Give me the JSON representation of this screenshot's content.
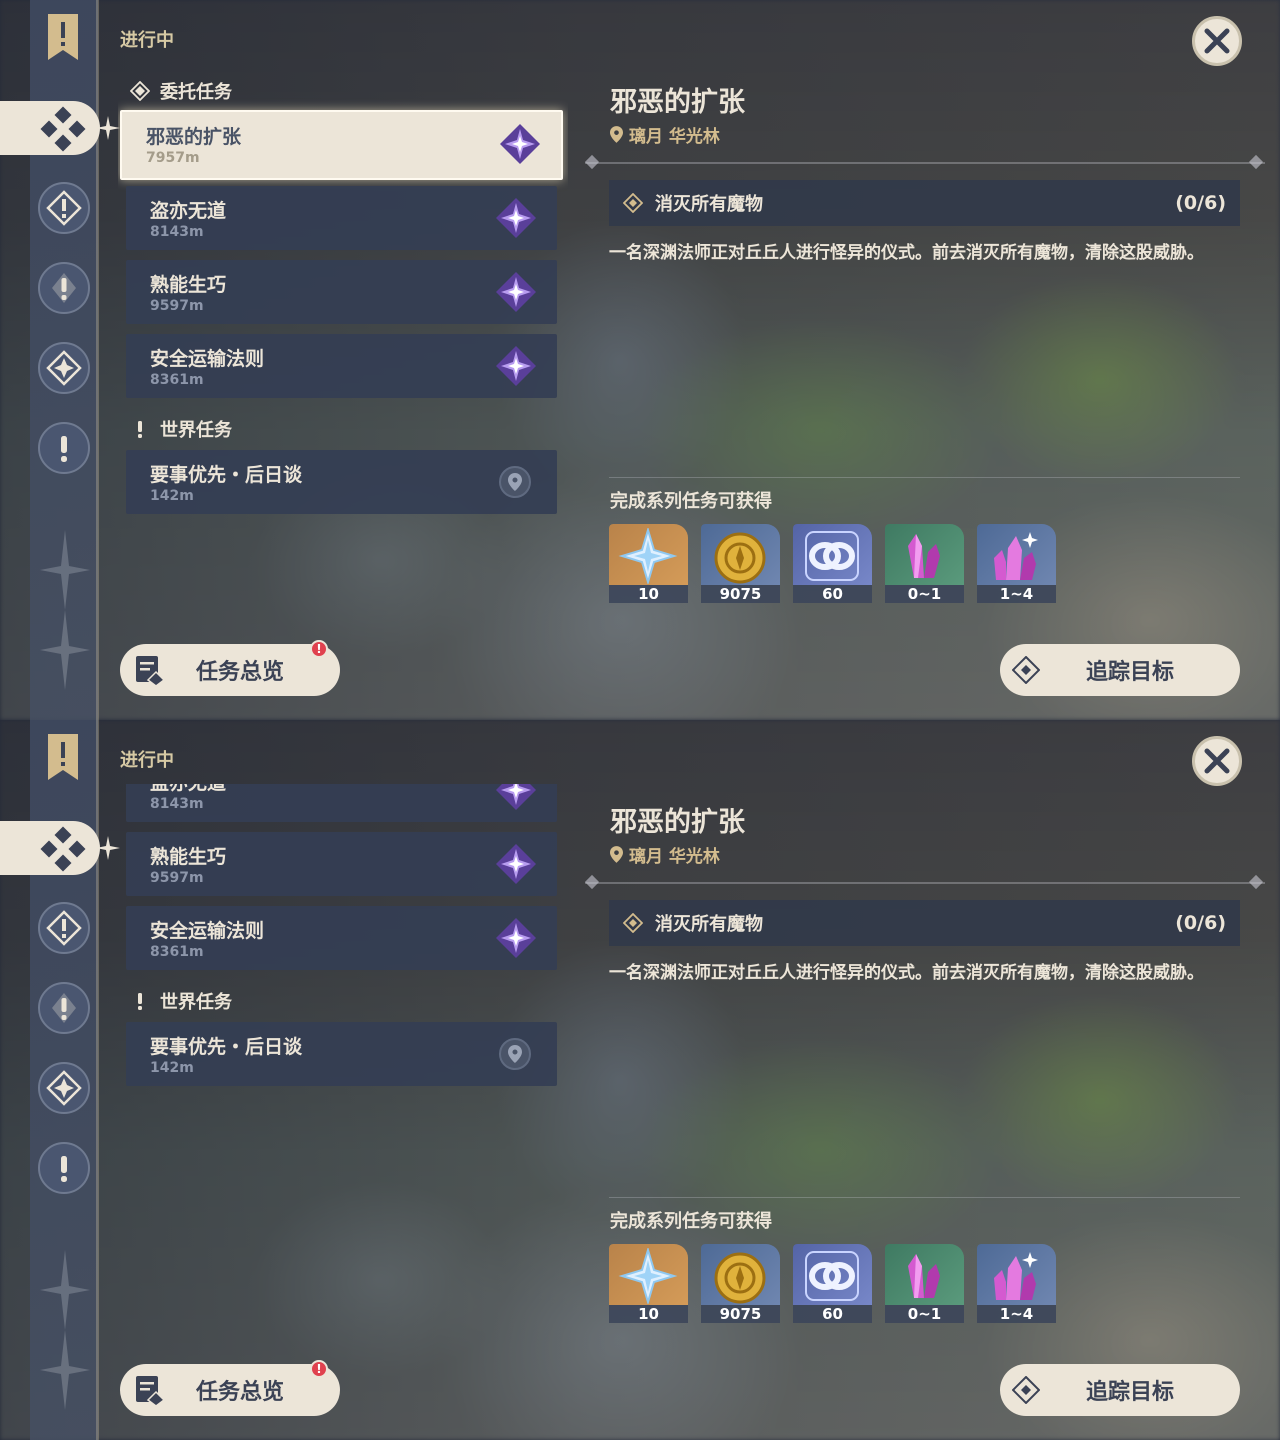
{
  "panels": [
    {
      "section_title": "进行中",
      "categories": {
        "commission": "委托任务",
        "world": "世界任务"
      },
      "quests": [
        {
          "name": "邪恶的扩张",
          "distance": "7957m",
          "active": true
        },
        {
          "name": "盗亦无道",
          "distance": "8143m"
        },
        {
          "name": "熟能生巧",
          "distance": "9597m"
        },
        {
          "name": "安全运输法则",
          "distance": "8361m"
        },
        {
          "name": "要事优先・后日谈",
          "distance": "142m"
        }
      ],
      "detail": {
        "title": "邪恶的扩张",
        "location": "璃月 华光林",
        "objective": "消灭所有魔物",
        "objective_count": "(0/6)",
        "description": "一名深渊法师正对丘丘人进行怪异的仪式。前去消灭所有魔物，清除这股威胁。",
        "rewards_title": "完成系列任务可获得",
        "rewards": [
          {
            "icon": "primogem-icon",
            "qty": "10"
          },
          {
            "icon": "mora-icon",
            "qty": "9075"
          },
          {
            "icon": "companionship-exp-icon",
            "qty": "60"
          },
          {
            "icon": "crystal-green-icon",
            "qty": "0~1"
          },
          {
            "icon": "crystal-blue-icon",
            "qty": "1~4"
          }
        ]
      },
      "buttons": {
        "overview": "任务总览",
        "track": "追踪目标",
        "alert": "!"
      }
    },
    {
      "section_title": "进行中",
      "categories": {
        "world": "世界任务"
      },
      "quests": [
        {
          "name": "盗亦无道",
          "distance": "8143m"
        },
        {
          "name": "熟能生巧",
          "distance": "9597m"
        },
        {
          "name": "安全运输法则",
          "distance": "8361m"
        },
        {
          "name": "要事优先・后日谈",
          "distance": "142m"
        }
      ],
      "detail": {
        "title": "邪恶的扩张",
        "location": "璃月 华光林",
        "objective": "消灭所有魔物",
        "objective_count": "(0/6)",
        "description": "一名深渊法师正对丘丘人进行怪异的仪式。前去消灭所有魔物，清除这股威胁。",
        "rewards_title": "完成系列任务可获得",
        "rewards": [
          {
            "icon": "primogem-icon",
            "qty": "10"
          },
          {
            "icon": "mora-icon",
            "qty": "9075"
          },
          {
            "icon": "companionship-exp-icon",
            "qty": "60"
          },
          {
            "icon": "crystal-green-icon",
            "qty": "0~1"
          },
          {
            "icon": "crystal-blue-icon",
            "qty": "1~4"
          }
        ]
      },
      "buttons": {
        "overview": "任务总览",
        "track": "追踪目标",
        "alert": "!"
      }
    }
  ],
  "colors": {
    "cream": "#ece5d8",
    "gold": "#d3bc8e",
    "card": "#343e54",
    "alert": "#e0414e",
    "commission_purple": "#8a5cd8"
  }
}
